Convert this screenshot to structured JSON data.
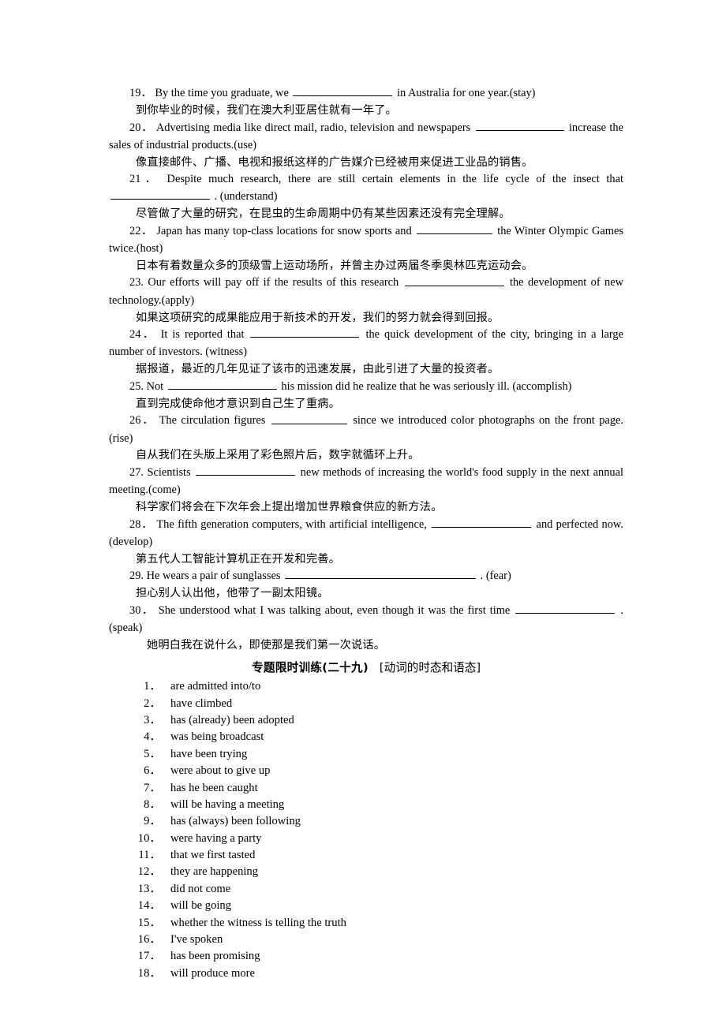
{
  "page": {
    "background": "#ffffff",
    "text_color": "#000000"
  },
  "exercises": [
    {
      "id": "q19",
      "number": "19．",
      "text_before": "By the time you graduate, we",
      "blank": "w-lg",
      "text_after": "in Australia for one year.(stay)",
      "translation": "到你毕业的时候，我们在澳大利亚居住就有一年了。",
      "justified": false
    },
    {
      "id": "q20",
      "number": "20．",
      "text_before": "Advertising media like direct mail, radio, television and newspapers",
      "blank": "w-md",
      "text_after": "increase the sales of industrial products.(use)",
      "translation": "像直接邮件、广播、电视和报纸这样的广告媒介已经被用来促进工业品的销售。",
      "justified": true,
      "blank_leads_second_line": true
    },
    {
      "id": "q21",
      "number": "21．",
      "text_before": "Despite much research, there are still certain elements in the life cycle of the insect that",
      "blank": "w-lg",
      "text_after": ". (understand)",
      "translation": "尽管做了大量的研究，在昆虫的生命周期中仍有某些因素还没有完全理解。",
      "justified": false,
      "blank_leads_second_line": true
    },
    {
      "id": "q22",
      "number": "22．",
      "text_before": "Japan has many top-class locations for snow sports and",
      "blank": "w-sm",
      "text_after": "the Winter Olympic Games twice.(host)",
      "translation": "日本有着数量众多的顶级雪上运动场所，并曾主办过两届冬季奥林匹克运动会。",
      "justified": true
    },
    {
      "id": "q23",
      "number": "23.",
      "text_before": "Our efforts will pay off if the results of this research",
      "blank": "w-lg",
      "text_after": "the development of new technology.(apply)",
      "translation": "如果这项研究的成果能应用于新技术的开发，我们的努力就会得到回报。",
      "justified": false
    },
    {
      "id": "q24",
      "number": "24．",
      "text_before": "It is reported that",
      "blank": "w-xl",
      "text_after": "the quick development of the city, bringing in a large number of investors. (witness)",
      "translation": "据报道，最近的几年见证了该市的迅速发展，由此引进了大量的投资者。",
      "justified": false
    },
    {
      "id": "q25",
      "number": "25.",
      "text_before": "Not",
      "blank": "w-xl",
      "text_after": "his mission did he realize that he was seriously ill. (accomplish)",
      "translation": "直到完成使命他才意识到自己生了重病。",
      "justified": false
    },
    {
      "id": "q26",
      "number": "26．",
      "text_before": "The circulation figures",
      "blank": "w-sm",
      "text_after": "since we introduced color photographs on the front page. (rise)",
      "translation": "自从我们在头版上采用了彩色照片后，数字就循环上升。",
      "justified": false
    },
    {
      "id": "q27",
      "number": "27.",
      "text_before": "Scientists",
      "blank": "w-lg",
      "text_after": "new methods of increasing the world's food supply in the next annual meeting.(come)",
      "translation": "科学家们将会在下次年会上提出增加世界粮食供应的新方法。",
      "justified": false
    },
    {
      "id": "q28",
      "number": "28．",
      "text_before": "The fifth generation computers, with artificial intelligence,",
      "blank": "w-lg",
      "text_after": "and perfected now. (develop)",
      "translation": "第五代人工智能计算机正在开发和完善。",
      "justified": true
    },
    {
      "id": "q29",
      "number": "29.",
      "text_before": "He wears a pair of sunglasses",
      "blank": "w-huge",
      "text_after": ". (fear)",
      "translation": "担心别人认出他，他带了一副太阳镜。",
      "justified": false
    },
    {
      "id": "q30",
      "number": "30．",
      "text_before": "She understood what I was talking about, even though it was the first time",
      "blank": "w-lg",
      "text_after": ".(speak)",
      "translation": "她明白我在说什么，即使那是我们第一次说话。",
      "justified": true,
      "blank_leads_second_line": true,
      "translation_deep_indent": true
    }
  ],
  "section_heading": {
    "title": "专题限时训练(二十九)",
    "topic": "[动词的时态和语态]"
  },
  "answers": [
    {
      "number": "1．",
      "text": "are admitted into/to"
    },
    {
      "number": "2．",
      "text": "have climbed"
    },
    {
      "number": "3．",
      "text": "has (already) been adopted"
    },
    {
      "number": "4．",
      "text": "was being broadcast"
    },
    {
      "number": "5．",
      "text": "have been trying"
    },
    {
      "number": "6．",
      "text": "were about to give up"
    },
    {
      "number": "7．",
      "text": "has he been caught"
    },
    {
      "number": "8．",
      "text": "will be having a meeting"
    },
    {
      "number": "9．",
      "text": "has (always) been following"
    },
    {
      "number": "10．",
      "text": "were having a party"
    },
    {
      "number": "11．",
      "text": "that we first tasted"
    },
    {
      "number": "12．",
      "text": "they are happening"
    },
    {
      "number": "13．",
      "text": "did not come"
    },
    {
      "number": "14．",
      "text": "will be going"
    },
    {
      "number": "15．",
      "text": "whether the witness is telling the truth"
    },
    {
      "number": "16．",
      "text": "I've spoken"
    },
    {
      "number": "17．",
      "text": "has been promising"
    },
    {
      "number": "18．",
      "text": "will produce more"
    }
  ]
}
